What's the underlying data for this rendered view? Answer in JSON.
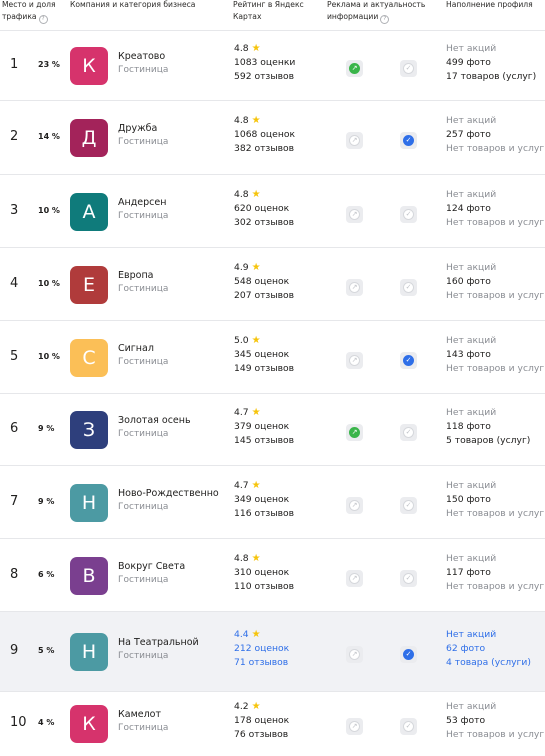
{
  "header": {
    "col_place": "Место и доля трафика",
    "col_company": "Компания и категория бизнеса",
    "col_rating": "Рейтинг в Яндекс Картах",
    "col_ads": "Реклама и актуальность информации",
    "col_profile": "Наполнение профиля",
    "help_glyph": "?"
  },
  "colors": {
    "star": "#f6c40c",
    "ad_active": "#3ab54a",
    "actual_active": "#2f6fe8",
    "highlight_text": "#2f6fe8",
    "highlight_bg": "#f1f2f5"
  },
  "rows": [
    {
      "rank": "1",
      "share": "23 %",
      "letter": "К",
      "avatar_color": "#d6336c",
      "name": "Креатово",
      "category": "Гостиница",
      "rating": "4.8",
      "ratings_count": "1083 оценки",
      "reviews": "592 отзывов",
      "ad": true,
      "actual": false,
      "promos": "Нет акций",
      "photos": "499 фото",
      "goods": "17 товаров (услуг)",
      "goods_muted": false,
      "highlight": false
    },
    {
      "rank": "2",
      "share": "14 %",
      "letter": "Д",
      "avatar_color": "#a3235a",
      "name": "Дружба",
      "category": "Гостиница",
      "rating": "4.8",
      "ratings_count": "1068 оценок",
      "reviews": "382 отзывов",
      "ad": false,
      "actual": true,
      "promos": "Нет акций",
      "photos": "257 фото",
      "goods": "Нет товаров и услуг",
      "goods_muted": true,
      "highlight": false
    },
    {
      "rank": "3",
      "share": "10 %",
      "letter": "А",
      "avatar_color": "#0f7b7b",
      "name": "Андерсен",
      "category": "Гостиница",
      "rating": "4.8",
      "ratings_count": "620 оценок",
      "reviews": "302 отзывов",
      "ad": false,
      "actual": false,
      "promos": "Нет акций",
      "photos": "124 фото",
      "goods": "Нет товаров и услуг",
      "goods_muted": true,
      "highlight": false
    },
    {
      "rank": "4",
      "share": "10 %",
      "letter": "Е",
      "avatar_color": "#b03b3b",
      "name": "Европа",
      "category": "Гостиница",
      "rating": "4.9",
      "ratings_count": "548 оценок",
      "reviews": "207 отзывов",
      "ad": false,
      "actual": false,
      "promos": "Нет акций",
      "photos": "160 фото",
      "goods": "Нет товаров и услуг",
      "goods_muted": true,
      "highlight": false
    },
    {
      "rank": "5",
      "share": "10 %",
      "letter": "С",
      "avatar_color": "#fbbf57",
      "name": "Сигнал",
      "category": "Гостиница",
      "rating": "5.0",
      "ratings_count": "345 оценок",
      "reviews": "149 отзывов",
      "ad": false,
      "actual": true,
      "promos": "Нет акций",
      "photos": "143 фото",
      "goods": "Нет товаров и услуг",
      "goods_muted": true,
      "highlight": false
    },
    {
      "rank": "6",
      "share": "9 %",
      "letter": "З",
      "avatar_color": "#2e3f7c",
      "name": "Золотая осень",
      "category": "Гостиница",
      "rating": "4.7",
      "ratings_count": "379 оценок",
      "reviews": "145 отзывов",
      "ad": true,
      "actual": false,
      "promos": "Нет акций",
      "photos": "118 фото",
      "goods": "5 товаров (услуг)",
      "goods_muted": false,
      "highlight": false
    },
    {
      "rank": "7",
      "share": "9 %",
      "letter": "Н",
      "avatar_color": "#4c9aa3",
      "name": "Ново-Рождественно",
      "category": "Гостиница",
      "rating": "4.7",
      "ratings_count": "349 оценок",
      "reviews": "116 отзывов",
      "ad": false,
      "actual": false,
      "promos": "Нет акций",
      "photos": "150 фото",
      "goods": "Нет товаров и услуг",
      "goods_muted": true,
      "highlight": false
    },
    {
      "rank": "8",
      "share": "6 %",
      "letter": "В",
      "avatar_color": "#7a3f8f",
      "name": "Вокруг Света",
      "category": "Гостиница",
      "rating": "4.8",
      "ratings_count": "310 оценок",
      "reviews": "110 отзывов",
      "ad": false,
      "actual": false,
      "promos": "Нет акций",
      "photos": "117 фото",
      "goods": "Нет товаров и услуг",
      "goods_muted": true,
      "highlight": false
    },
    {
      "rank": "9",
      "share": "5 %",
      "letter": "Н",
      "avatar_color": "#4c9aa3",
      "name": "На Театральной",
      "category": "Гостиница",
      "rating": "4.4",
      "ratings_count": "212 оценок",
      "reviews": "71 отзывов",
      "ad": false,
      "actual": true,
      "promos": "Нет акций",
      "photos": "62 фото",
      "goods": "4 товара (услуги)",
      "goods_muted": false,
      "highlight": true
    },
    {
      "rank": "10",
      "share": "4 %",
      "letter": "К",
      "avatar_color": "#d6336c",
      "name": "Камелот",
      "category": "Гостиница",
      "rating": "4.2",
      "ratings_count": "178 оценок",
      "reviews": "76 отзывов",
      "ad": false,
      "actual": false,
      "promos": "Нет акций",
      "photos": "53 фото",
      "goods": "Нет товаров и услуг",
      "goods_muted": true,
      "highlight": false
    }
  ]
}
